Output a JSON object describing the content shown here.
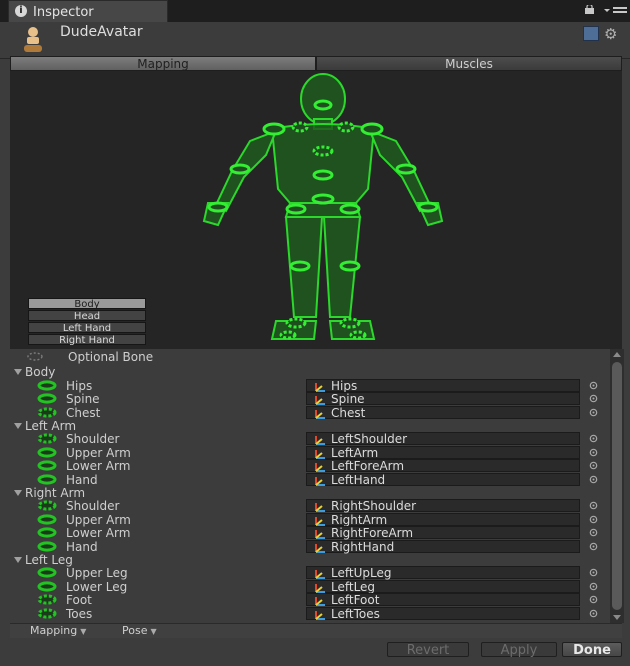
{
  "window": {
    "tab_title": "Inspector",
    "tab_icon": "info-icon"
  },
  "header": {
    "object_name": "DudeAvatar",
    "icon": "avatar-icon"
  },
  "tabs": {
    "mapping": "Mapping",
    "muscles": "Muscles",
    "selected": "Mapping"
  },
  "body_parts": [
    "Body",
    "Head",
    "Left Hand",
    "Right Hand"
  ],
  "selected_body_part": "Body",
  "legend": {
    "optional_bone": "Optional Bone"
  },
  "groups": [
    {
      "name": "Body",
      "bones": [
        {
          "label": "Hips",
          "required": true,
          "value": "Hips"
        },
        {
          "label": "Spine",
          "required": true,
          "value": "Spine"
        },
        {
          "label": "Chest",
          "required": false,
          "value": "Chest"
        }
      ]
    },
    {
      "name": "Left Arm",
      "bones": [
        {
          "label": "Shoulder",
          "required": false,
          "value": "LeftShoulder"
        },
        {
          "label": "Upper Arm",
          "required": true,
          "value": "LeftArm"
        },
        {
          "label": "Lower Arm",
          "required": true,
          "value": "LeftForeArm"
        },
        {
          "label": "Hand",
          "required": true,
          "value": "LeftHand"
        }
      ]
    },
    {
      "name": "Right Arm",
      "bones": [
        {
          "label": "Shoulder",
          "required": false,
          "value": "RightShoulder"
        },
        {
          "label": "Upper Arm",
          "required": true,
          "value": "RightArm"
        },
        {
          "label": "Lower Arm",
          "required": true,
          "value": "RightForeArm"
        },
        {
          "label": "Hand",
          "required": true,
          "value": "RightHand"
        }
      ]
    },
    {
      "name": "Left Leg",
      "bones": [
        {
          "label": "Upper Leg",
          "required": true,
          "value": "LeftUpLeg"
        },
        {
          "label": "Lower Leg",
          "required": true,
          "value": "LeftLeg"
        },
        {
          "label": "Foot",
          "required": false,
          "value": "LeftFoot"
        },
        {
          "label": "Toes",
          "required": false,
          "value": "LeftToes"
        }
      ]
    }
  ],
  "bottom": {
    "mapping_dropdown": "Mapping",
    "pose_dropdown": "Pose"
  },
  "actions": {
    "revert": "Revert",
    "apply": "Apply",
    "done": "Done"
  },
  "colors": {
    "mapped_green": "#22c322",
    "panel": "#3c3c3c",
    "viewport": "#252525",
    "bone_field": "#2a2a2a"
  }
}
